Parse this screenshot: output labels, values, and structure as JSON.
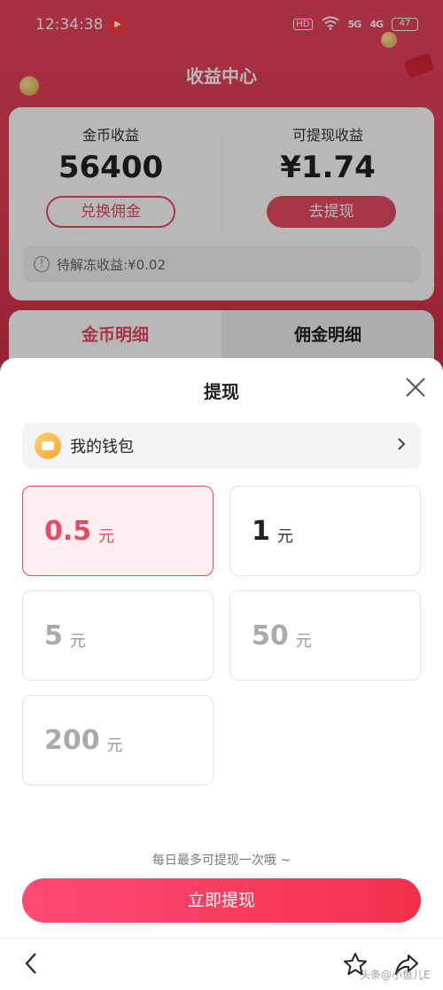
{
  "status_bar": {
    "time": "12:34:38",
    "app_badge": "▶",
    "hd": "HD",
    "net1": "5G",
    "net2": "4G",
    "battery": "47"
  },
  "background": {
    "title": "收益中心",
    "coins": {
      "label": "金币收益",
      "value": "56400",
      "button": "兑换佣金"
    },
    "cash": {
      "label": "可提现收益",
      "value": "¥1.74",
      "button": "去提现"
    },
    "pending": "待解冻收益:¥0.02",
    "tabs": [
      {
        "label": "金币明细",
        "active": true
      },
      {
        "label": "佣金明细",
        "active": false
      }
    ]
  },
  "sheet": {
    "title": "提现",
    "wallet_label": "我的钱包",
    "amounts": [
      {
        "value": "0.5",
        "unit": "元",
        "state": "selected"
      },
      {
        "value": "1",
        "unit": "元",
        "state": "enabled"
      },
      {
        "value": "5",
        "unit": "元",
        "state": "disabled"
      },
      {
        "value": "50",
        "unit": "元",
        "state": "disabled"
      },
      {
        "value": "200",
        "unit": "元",
        "state": "disabled"
      }
    ],
    "hint": "每日最多可提现一次哦 ~",
    "cta": "立即提现"
  },
  "watermark": "头条@小鱼儿E",
  "colors": {
    "accent": "#e84a65",
    "selected_bg": "#ffeef2"
  },
  "icons": {
    "close": "close-icon",
    "wallet": "wallet-icon",
    "chevron": "chevron-right-icon",
    "back": "back-arrow-icon",
    "star": "star-icon",
    "share": "share-icon",
    "info": "info-icon"
  }
}
